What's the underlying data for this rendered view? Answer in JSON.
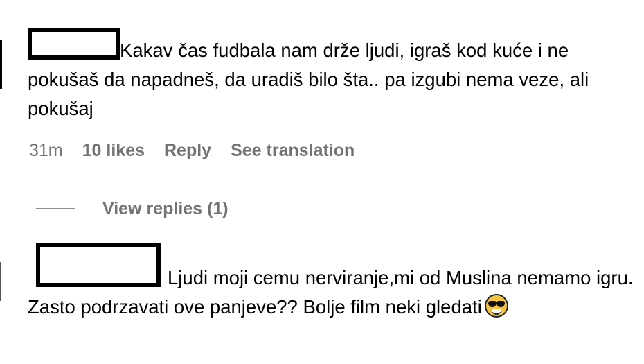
{
  "comment1": {
    "text": "Kakav čas fudbala nam drže ljudi, igraš kod kuće i ne pokušaš da napadneš, da uradiš bilo šta.. pa izgubi nema veze, ali pokušaj",
    "time": "31m",
    "likes": "10 likes",
    "reply_label": "Reply",
    "translation_label": "See translation",
    "view_replies": "View replies (1)"
  },
  "comment2": {
    "text": "Ljudi moji cemu nerviranje,mi od Muslina nemamo igru. Zasto podrzavati ove panjeve?? Bolje film neki gledati",
    "emoji": "smiling-face-with-sunglasses"
  }
}
